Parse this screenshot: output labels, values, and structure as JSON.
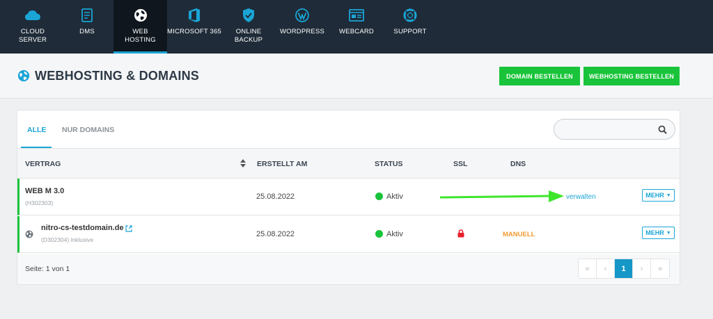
{
  "nav": {
    "items": [
      {
        "label": "CLOUD\nSERVER",
        "icon": "cloud-icon"
      },
      {
        "label": "DMS",
        "icon": "document-icon"
      },
      {
        "label": "WEB\nHOSTING",
        "icon": "globe-icon",
        "active": true
      },
      {
        "label": "MICROSOFT 365",
        "icon": "office-icon"
      },
      {
        "label": "ONLINE\nBACKUP",
        "icon": "shield-icon"
      },
      {
        "label": "WORDPRESS",
        "icon": "wordpress-icon"
      },
      {
        "label": "WEBCARD",
        "icon": "webcard-icon"
      },
      {
        "label": "SUPPORT",
        "icon": "lifebuoy-icon"
      }
    ]
  },
  "header": {
    "title": "WEBHOSTING & DOMAINS",
    "order_domain": "DOMAIN BESTELLEN",
    "order_hosting": "WEBHOSTING BESTELLEN"
  },
  "tabs": {
    "all": "ALLE",
    "domains_only": "NUR DOMAINS"
  },
  "search": {
    "placeholder": ""
  },
  "table": {
    "headers": {
      "contract": "VERTRAG",
      "created": "ERSTELLT AM",
      "status": "STATUS",
      "ssl": "SSL",
      "dns": "DNS"
    },
    "rows": [
      {
        "name": "WEB M 3.0",
        "sub": "(H302303)",
        "created": "25.08.2022",
        "status": "Aktiv",
        "dns_link": "verwalten",
        "more": "MEHR"
      },
      {
        "name": "nitro-cs-testdomain.de",
        "sub": "(D302304) inklusive",
        "created": "25.08.2022",
        "status": "Aktiv",
        "dns": "MANUELL",
        "more": "MEHR"
      }
    ]
  },
  "footer": {
    "page_info": "Seite: 1 von 1",
    "pager": [
      "«",
      "‹",
      "1",
      "›",
      "»"
    ],
    "current_page": "1"
  },
  "colors": {
    "nav_bg": "#1f2b38",
    "accent_blue": "#1aa5d6",
    "green": "#19c43a",
    "dns_orange": "#f29a2e",
    "lock_red": "#e8202a"
  }
}
